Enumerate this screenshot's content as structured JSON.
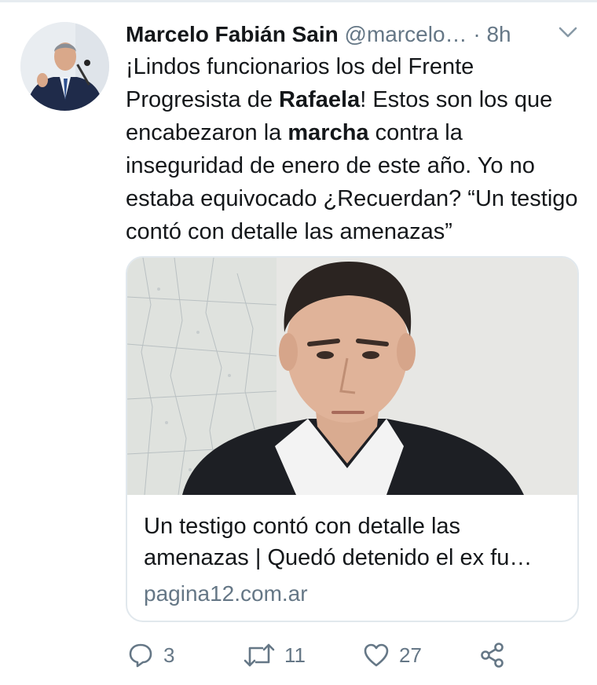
{
  "tweet": {
    "author_name": "Marcelo Fabián Sain",
    "handle": "@marcelo…",
    "separator": "·",
    "time": "8h",
    "text": {
      "p1": "¡Lindos funcionarios los del Frente Progresista de ",
      "b1": "Rafaela",
      "p2": "! Estos son los que encabezaron la ",
      "b2": "marcha",
      "p3": " contra la inseguridad de enero de este año. Yo no estaba equivocado ¿Recuerdan? “Un testigo contó con detalle las amenazas”"
    }
  },
  "card": {
    "title": "Un testigo contó con detalle las amenazas  | Quedó detenido el ex fu…",
    "domain": "pagina12.com.ar"
  },
  "actions": {
    "reply_count": "3",
    "retweet_count": "11",
    "like_count": "27"
  },
  "icons": {
    "reply": "reply-icon",
    "retweet": "retweet-icon",
    "like": "heart-icon",
    "share": "share-icon",
    "menu": "chevron-down-icon"
  },
  "colors": {
    "text": "#14171a",
    "secondary": "#657786",
    "border": "#e1e8ed"
  }
}
